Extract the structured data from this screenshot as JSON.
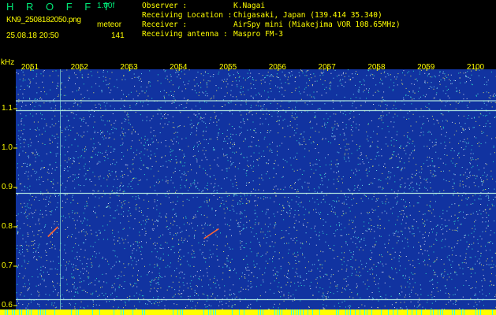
{
  "header": {
    "app_title": "H R O F F T",
    "version": "1.00f",
    "file_name": "KN9_2508182050.png",
    "meteor_label": "meteor",
    "datetime": "25.08.18 20:50",
    "count": "141",
    "observer_key": "Observer           :",
    "observer_val": "K.Nagai",
    "location_key": "Receiving Location :",
    "location_val": "Chigasaki, Japan (139.414 35.340)",
    "receiver_key": "Receiver           :",
    "receiver_val": "AirSpy mini (Miakejima VOR 108.65MHz)",
    "antenna_key": "Receiving antenna  :",
    "antenna_val": "Maspro FM-3"
  },
  "chart_data": {
    "type": "heatmap",
    "ylabel": "kHz",
    "y_ticks": [
      "1.1",
      "1.0",
      "0.9",
      "0.8",
      "0.7",
      "0.6"
    ],
    "y_tick_values": [
      1.1,
      1.0,
      0.9,
      0.8,
      0.7,
      0.6
    ],
    "ylim": [
      0.59,
      1.2
    ],
    "x_ticks": [
      "2051",
      "2052",
      "2053",
      "2054",
      "2055",
      "2056",
      "2057",
      "2058",
      "2059",
      "2100"
    ],
    "x_tick_values": [
      2051,
      2052,
      2053,
      2054,
      2055,
      2056,
      2057,
      2058,
      2059,
      2100
    ],
    "xlim": [
      2050.7,
      2100.4
    ],
    "horizontal_lines_khz": [
      1.12,
      1.095,
      0.885,
      0.615
    ],
    "vertical_lines": [
      2051.6
    ],
    "meteor_traces": [
      {
        "x0": 2051.35,
        "y0": 0.775,
        "x1": 2051.55,
        "y1": 0.8
      },
      {
        "x0": 2054.5,
        "y0": 0.77,
        "x1": 2054.8,
        "y1": 0.795
      }
    ],
    "colors": {
      "background": "#1133a0",
      "noise": [
        "#ffffff",
        "#7ff6ff",
        "#33ffcc",
        "#ffff66"
      ],
      "tick_labels": "#ffff00",
      "bottom_strip": "#ffff00"
    },
    "grid": true
  }
}
